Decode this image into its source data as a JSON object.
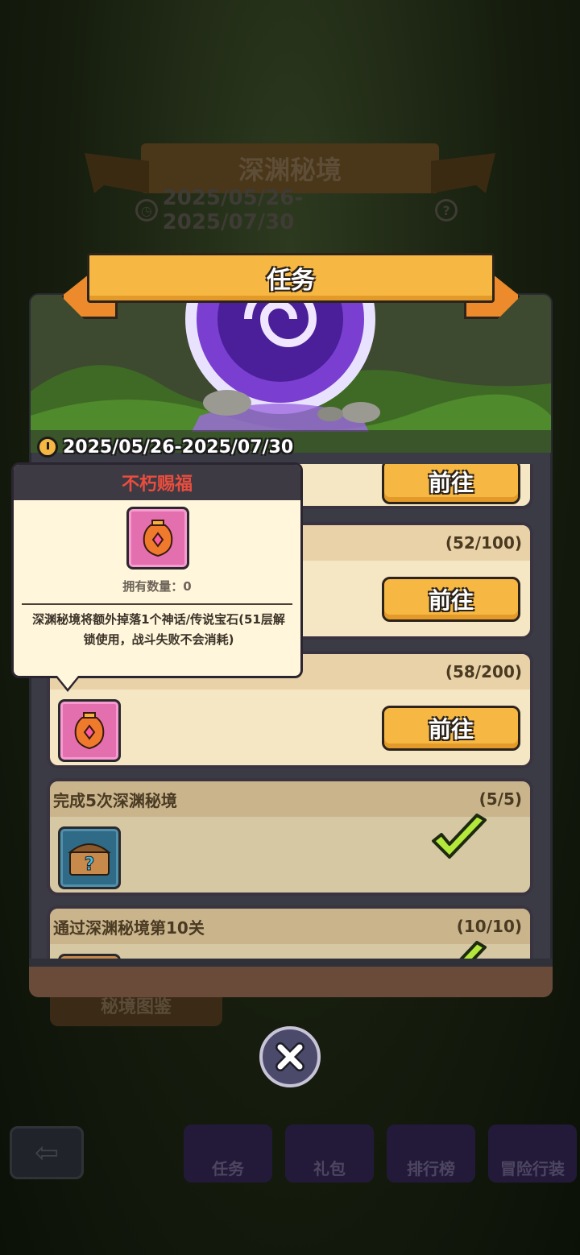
{
  "background": {
    "event_title": "深渊秘境",
    "event_dates": "2025/05/26-2025/07/30",
    "codex_button": "秘境图鉴",
    "nav": [
      {
        "label": "任务",
        "icon": "clipboard-icon"
      },
      {
        "label": "礼包",
        "icon": "gift-icon"
      },
      {
        "label": "排行榜",
        "icon": "podium-icon"
      },
      {
        "label": "冒险行装",
        "icon": "cycle-card-icon"
      }
    ]
  },
  "modal": {
    "title": "任务",
    "dates": "2025/05/26-2025/07/30",
    "tasks": [
      {
        "name": "",
        "progress": "",
        "button": "前往",
        "reward_icon": "",
        "done": false
      },
      {
        "name": "",
        "progress": "(52/100)",
        "button": "前往",
        "reward_icon": "",
        "done": false
      },
      {
        "name": "",
        "progress": "(58/200)",
        "button": "前往",
        "reward_icon": "immortal-blessing-vase-icon",
        "done": false
      },
      {
        "name": "完成5次深渊秘境",
        "progress": "(5/5)",
        "button": "",
        "reward_icon": "mystery-chest-icon",
        "done": true
      },
      {
        "name": "通过深渊秘境第10关",
        "progress": "(10/10)",
        "button": "",
        "reward_icon": "",
        "done": true
      }
    ]
  },
  "tooltip": {
    "title": "不朽赐福",
    "owned_count": "拥有数量：0",
    "description": "深渊秘境将额外掉落1个神话/传说宝石(51层解锁使用，战斗失败不会消耗)"
  },
  "colors": {
    "accent_yellow": "#f7b843",
    "tooltip_title_red": "#ea4d3d",
    "check_green": "#b4e83a"
  }
}
